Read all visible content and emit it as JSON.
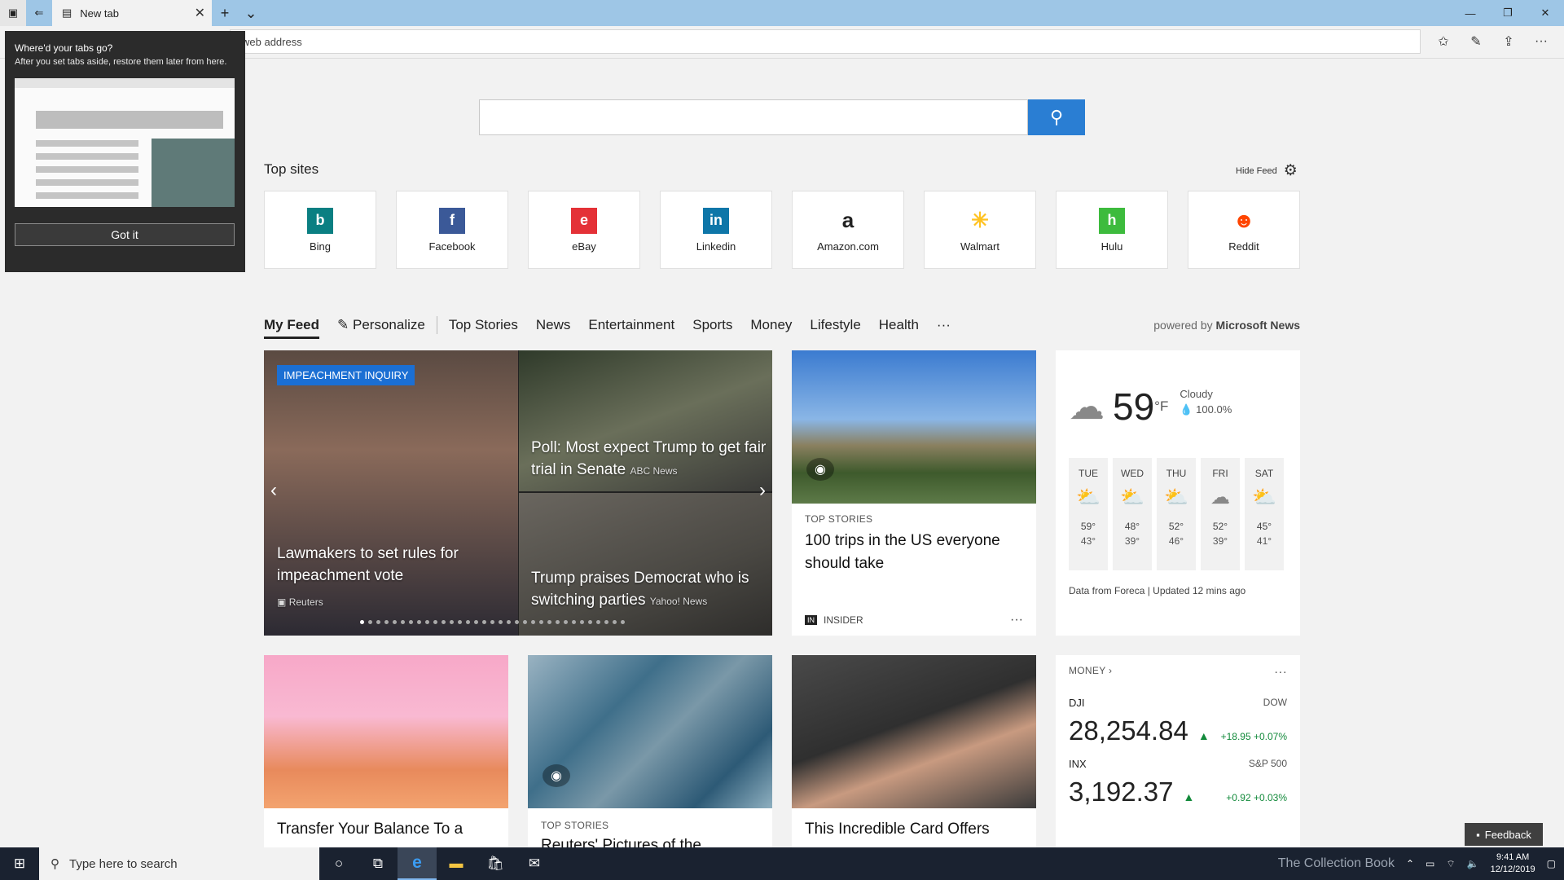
{
  "browser": {
    "tab_title": "New tab",
    "address_placeholder": "web address"
  },
  "popup": {
    "title": "Where'd your tabs go?",
    "body": "After you set tabs aside, restore them later from here.",
    "button": "Got it"
  },
  "top_sites": {
    "title": "Top sites",
    "hide_feed": "Hide Feed",
    "sites": [
      {
        "name": "Bing",
        "color": "#0a7f82",
        "glyph": "b"
      },
      {
        "name": "Facebook",
        "color": "#3b5998",
        "glyph": "f"
      },
      {
        "name": "eBay",
        "color": "#e43137",
        "glyph": "e"
      },
      {
        "name": "Linkedin",
        "color": "#0e76a8",
        "glyph": "in"
      },
      {
        "name": "Amazon.com",
        "color": "#222222",
        "glyph": "a"
      },
      {
        "name": "Walmart",
        "color": "#ffc220",
        "glyph": "✳"
      },
      {
        "name": "Hulu",
        "color": "#3dbb3d",
        "glyph": "h"
      },
      {
        "name": "Reddit",
        "color": "#ff4500",
        "glyph": "☻"
      }
    ]
  },
  "feed_nav": {
    "items": [
      "My Feed",
      "Personalize",
      "Top Stories",
      "News",
      "Entertainment",
      "Sports",
      "Money",
      "Lifestyle",
      "Health",
      "···"
    ],
    "powered_prefix": "powered by",
    "powered_brand": "Microsoft News"
  },
  "hero": {
    "badge": "IMPEACHMENT INQUIRY",
    "main_headline": "Lawmakers to set rules for impeachment vote",
    "main_source": "Reuters",
    "top_headline": "Poll: Most expect Trump to get fair trial in Senate",
    "top_source": "ABC News",
    "bottom_headline": "Trump praises Democrat who is switching parties",
    "bottom_source": "Yahoo! News"
  },
  "story1": {
    "category": "TOP STORIES",
    "title": "100 trips in the US everyone should take",
    "source": "INSIDER",
    "more": "···"
  },
  "weather": {
    "temp": "59",
    "unit": "°F",
    "condition": "Cloudy",
    "precip": "100.0%",
    "days": [
      {
        "day": "TUE",
        "hi": "59°",
        "lo": "43°",
        "icon": "partly-sunny"
      },
      {
        "day": "WED",
        "hi": "48°",
        "lo": "39°",
        "icon": "partly-sunny"
      },
      {
        "day": "THU",
        "hi": "52°",
        "lo": "46°",
        "icon": "partly-sunny"
      },
      {
        "day": "FRI",
        "hi": "52°",
        "lo": "39°",
        "icon": "cloudy"
      },
      {
        "day": "SAT",
        "hi": "45°",
        "lo": "41°",
        "icon": "partly-sunny"
      }
    ],
    "footer": "Data from Foreca | Updated 12 mins ago"
  },
  "money": {
    "header": "MONEY",
    "more": "···",
    "dji_label": "DJI",
    "dji_name": "DOW",
    "dji_value": "28,254.84",
    "dji_change": "+18.95 +0.07%",
    "inx_label": "INX",
    "inx_name": "S&P 500",
    "inx_value": "3,192.37",
    "inx_change": "+0.92 +0.03%"
  },
  "row2": {
    "card1_title": "Transfer Your Balance To a",
    "card2_category": "TOP STORIES",
    "card2_title": "Reuters' Pictures of the",
    "card3_title": "This Incredible Card Offers"
  },
  "feedback": "Feedback",
  "taskbar": {
    "search_placeholder": "Type here to search",
    "watermark": "The Collection Book",
    "time": "9:41 AM",
    "date": "12/12/2019"
  }
}
